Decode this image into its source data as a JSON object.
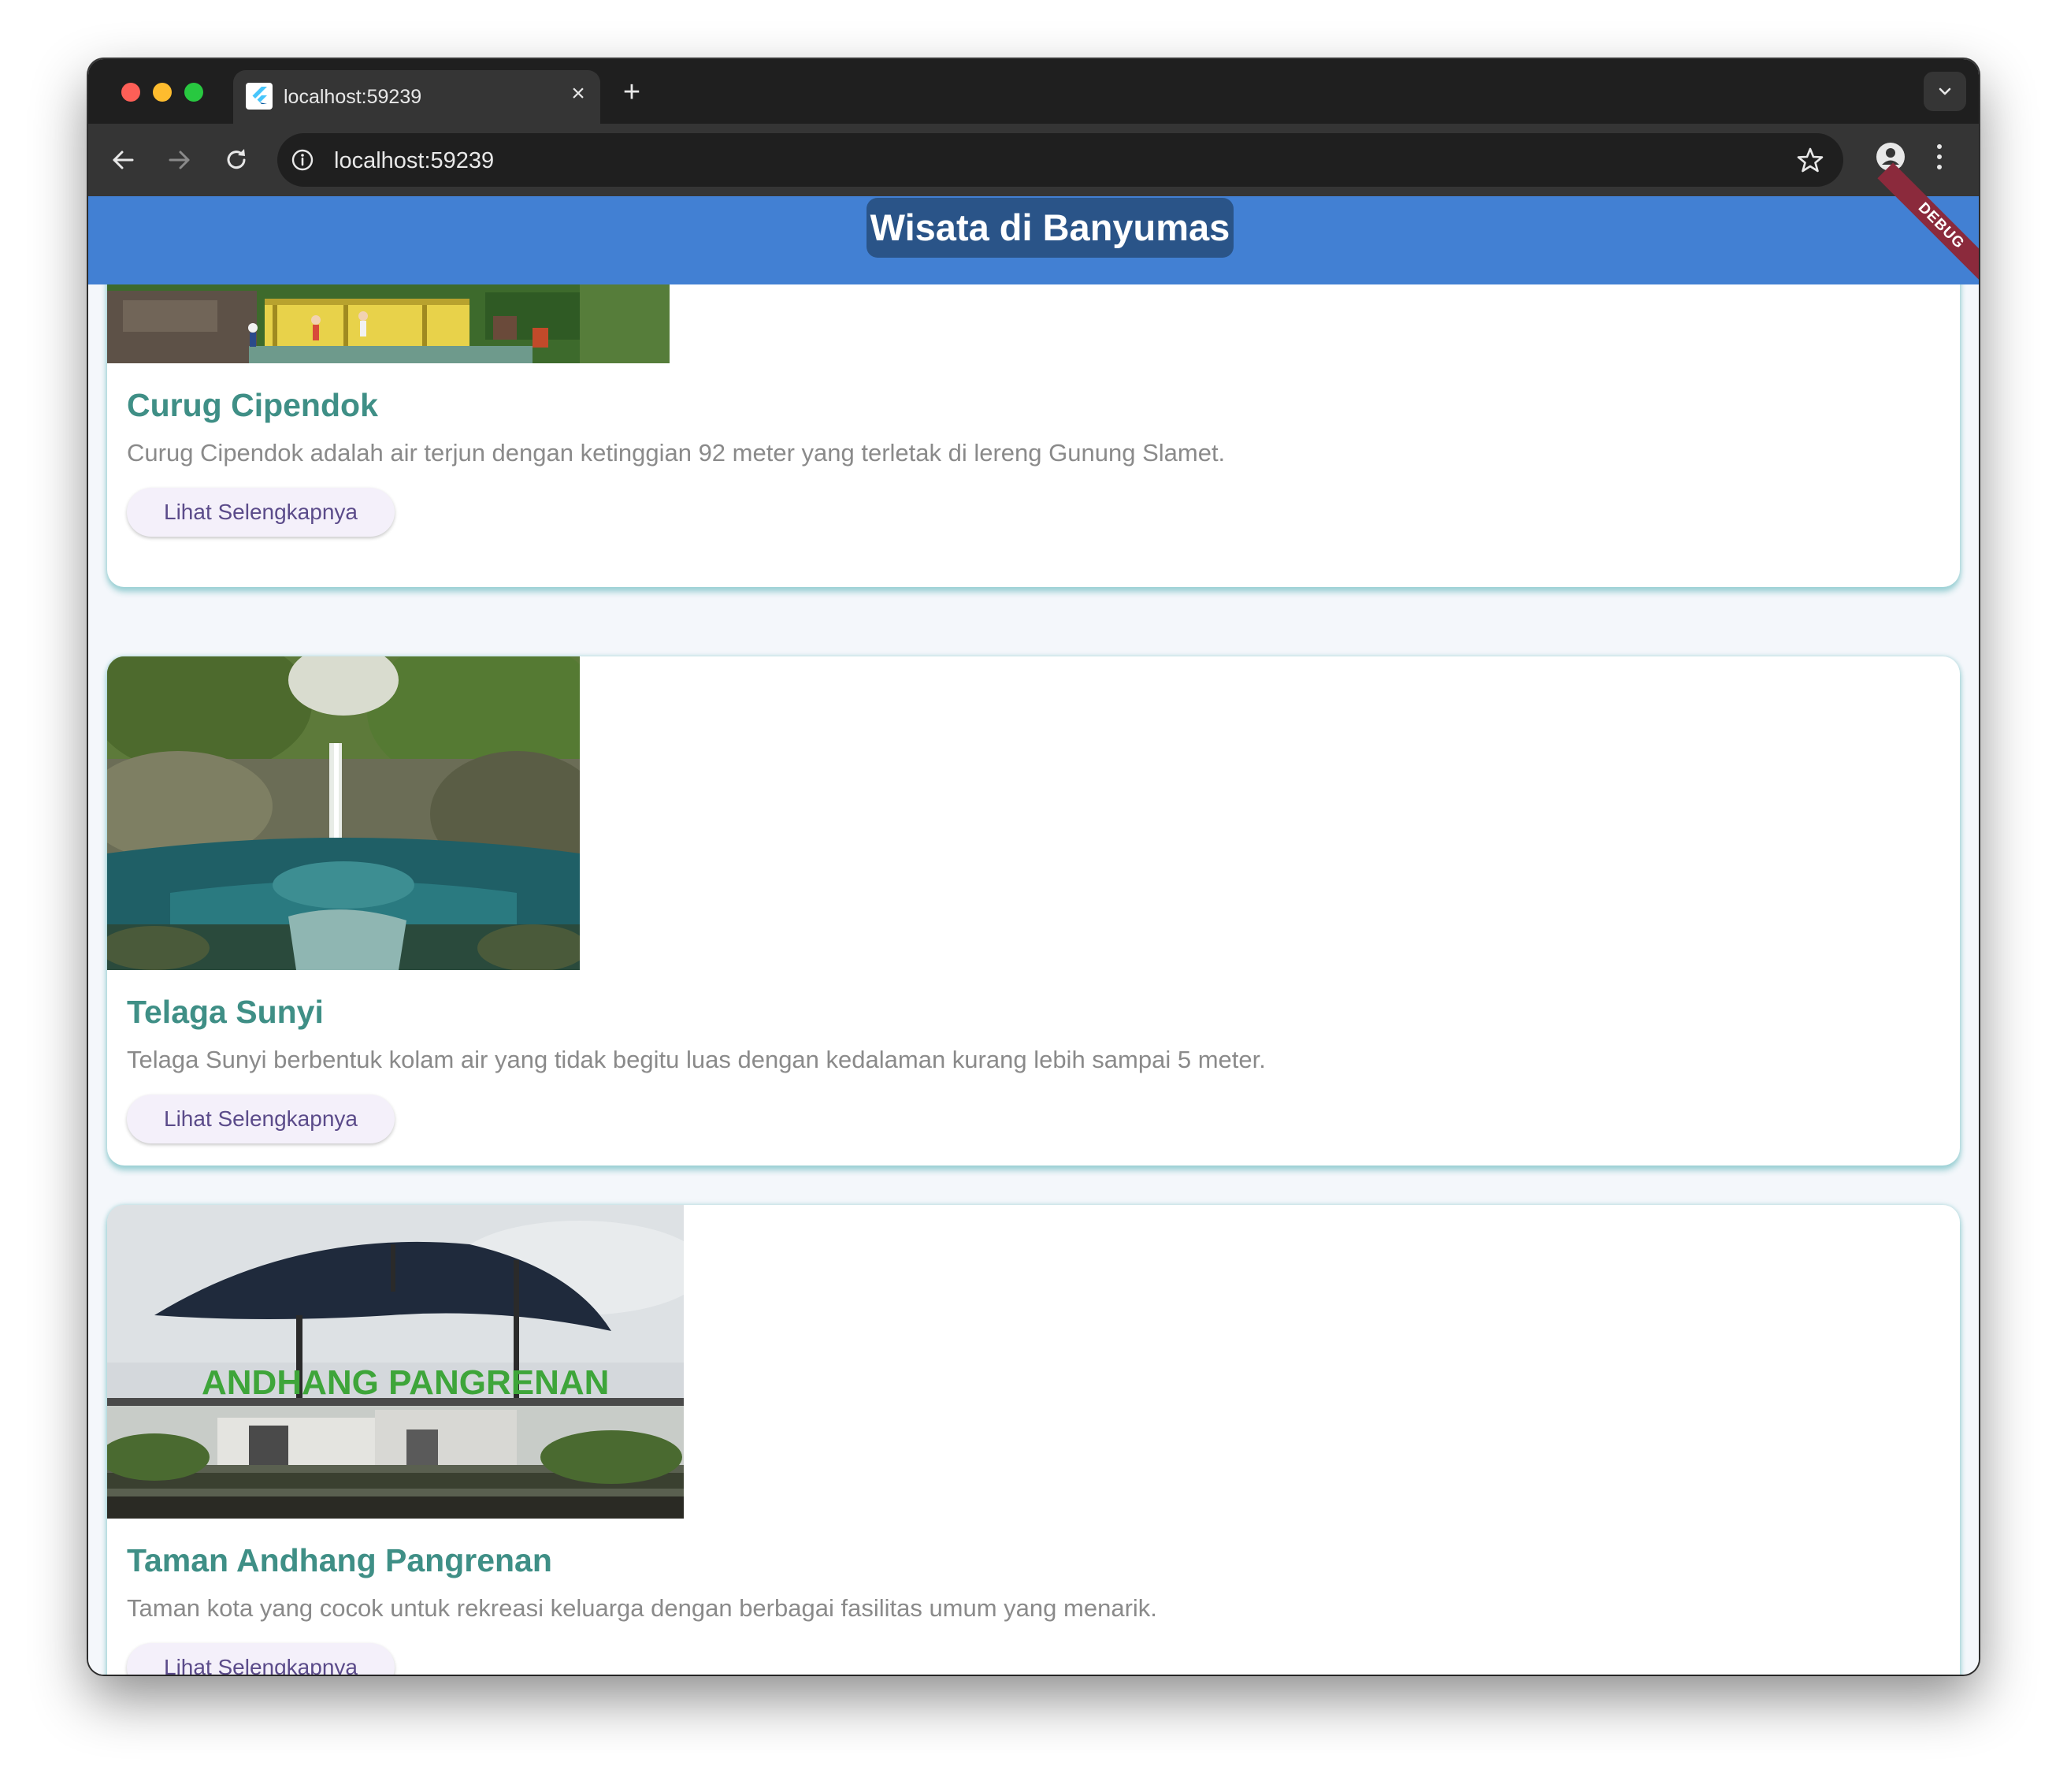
{
  "browser": {
    "tab_title": "localhost:59239",
    "address": "localhost:59239",
    "icons": {
      "close": "close-icon",
      "new_tab": "plus-icon",
      "tab_menu": "chevron-down-icon",
      "back": "arrow-left-icon",
      "forward": "arrow-right-icon",
      "reload": "reload-icon",
      "site_info": "info-icon",
      "bookmark": "star-icon",
      "profile": "profile-icon",
      "menu": "kebab-icon"
    }
  },
  "app": {
    "title": "Wisata di Banyumas",
    "debug_banner": "DEBUG",
    "colors": {
      "appbar": "#4280d3",
      "title_pill": "#2a5488",
      "card_title": "#3f8f86",
      "button_text": "#5b4b8a"
    }
  },
  "destinations": [
    {
      "name": "Curug Cipendok",
      "description": "Curug Cipendok adalah air terjun dengan ketinggian 92 meter yang terletak di lereng Gunung Slamet.",
      "button_label": "Lihat Selengkapnya"
    },
    {
      "name": "Telaga Sunyi",
      "description": "Telaga Sunyi berbentuk kolam air yang tidak begitu luas dengan kedalaman kurang lebih sampai 5 meter.",
      "button_label": "Lihat Selengkapnya"
    },
    {
      "name": "Taman Andhang Pangrenan",
      "description": "Taman kota yang cocok untuk rekreasi keluarga dengan berbagai fasilitas umum yang menarik.",
      "button_label": "Lihat Selengkapnya",
      "image_sign_text": "ANDHANG PANGRENAN"
    }
  ]
}
